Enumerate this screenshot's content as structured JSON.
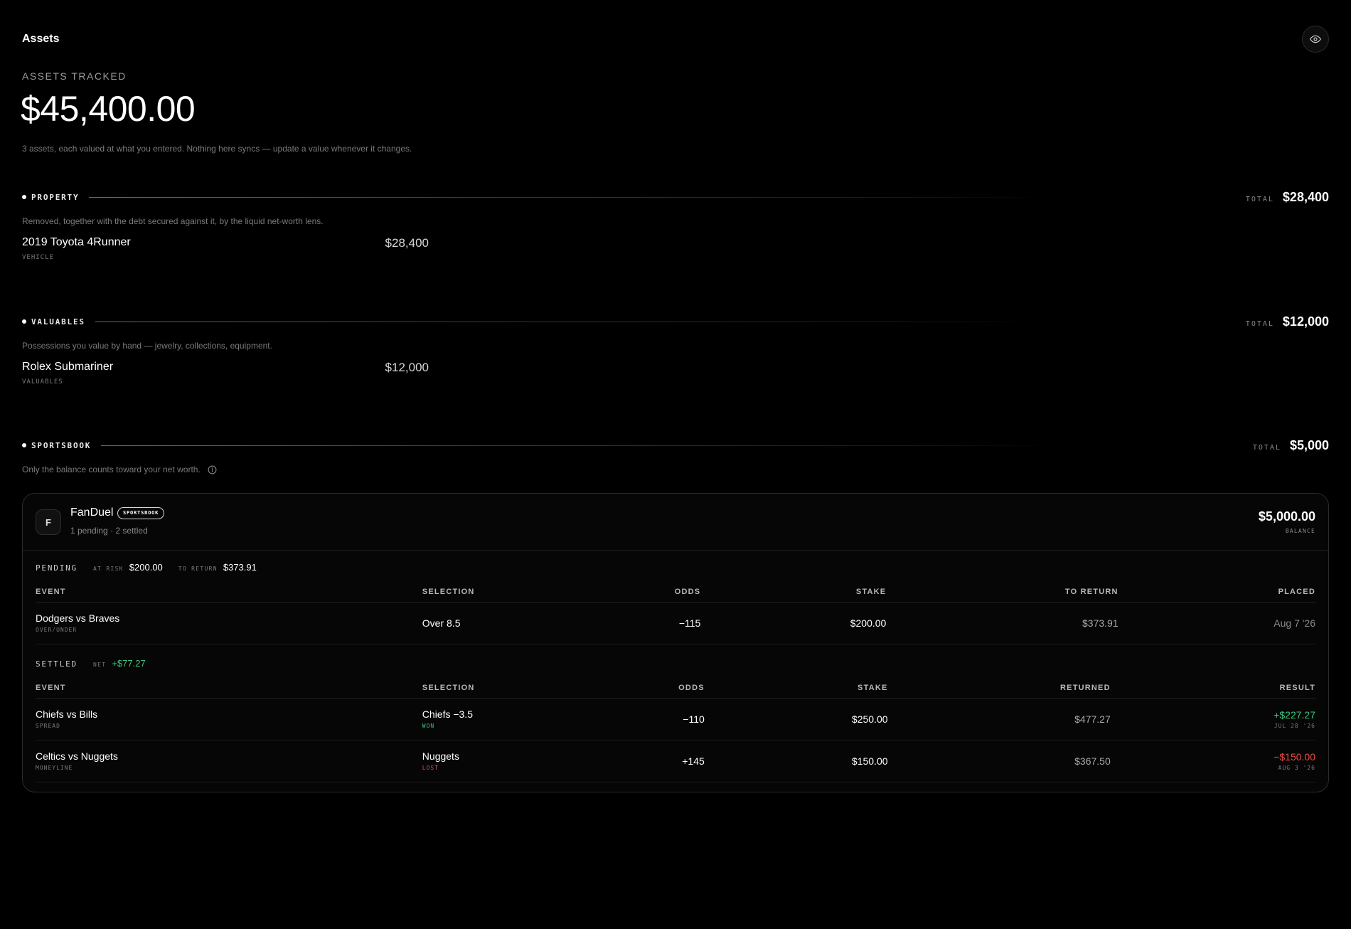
{
  "header": {
    "title": "Assets",
    "visibility_icon": "eye-icon"
  },
  "hero": {
    "label": "ASSETS TRACKED",
    "amount": "$45,400.00",
    "description": "3 assets, each valued at what you entered. Nothing here syncs — update a value whenever it changes."
  },
  "total_label": "TOTAL",
  "sections": {
    "property": {
      "name": "PROPERTY",
      "total": "$28,400",
      "description": "Removed, together with the debt secured against it, by the liquid net-worth lens.",
      "items": [
        {
          "name": "2019 Toyota 4Runner",
          "type": "VEHICLE",
          "value": "$28,400"
        }
      ]
    },
    "valuables": {
      "name": "VALUABLES",
      "total": "$12,000",
      "description": "Possessions you value by hand — jewelry, collections, equipment.",
      "items": [
        {
          "name": "Rolex Submariner",
          "type": "VALUABLES",
          "value": "$12,000"
        }
      ]
    },
    "sportsbook": {
      "name": "SPORTSBOOK",
      "total": "$5,000",
      "description": "Only the balance counts toward your net worth.",
      "info_icon": "info-icon"
    }
  },
  "account": {
    "avatar_letter": "F",
    "name": "FanDuel",
    "badge": "SPORTSBOOK",
    "subtitle": "1 pending · 2 settled",
    "balance": "$5,000.00",
    "balance_label": "BALANCE"
  },
  "pending": {
    "title": "PENDING",
    "at_risk_label": "AT RISK",
    "at_risk": "$200.00",
    "to_return_label": "TO RETURN",
    "to_return": "$373.91",
    "columns": [
      "EVENT",
      "SELECTION",
      "ODDS",
      "STAKE",
      "TO RETURN",
      "PLACED"
    ],
    "rows": [
      {
        "event": "Dodgers vs Braves",
        "market": "OVER/UNDER",
        "selection": "Over 8.5",
        "odds": "−115",
        "stake": "$200.00",
        "to_return": "$373.91",
        "placed": "Aug 7 '26"
      }
    ]
  },
  "settled": {
    "title": "SETTLED",
    "net_label": "NET",
    "net": "+$77.27",
    "columns": [
      "EVENT",
      "SELECTION",
      "ODDS",
      "STAKE",
      "RETURNED",
      "RESULT"
    ],
    "rows": [
      {
        "event": "Chiefs vs Bills",
        "market": "SPREAD",
        "selection": "Chiefs −3.5",
        "outcome": "WON",
        "odds": "−110",
        "stake": "$250.00",
        "returned": "$477.27",
        "result": "+$227.27",
        "date": "JUL 28 '26"
      },
      {
        "event": "Celtics vs Nuggets",
        "market": "MONEYLINE",
        "selection": "Nuggets",
        "outcome": "LOST",
        "odds": "+145",
        "stake": "$150.00",
        "returned": "$367.50",
        "result": "−$150.00",
        "date": "AUG 3 '26"
      }
    ]
  },
  "colors": {
    "positive": "#3ec47a",
    "negative": "#f04a3e",
    "background": "#000000"
  }
}
